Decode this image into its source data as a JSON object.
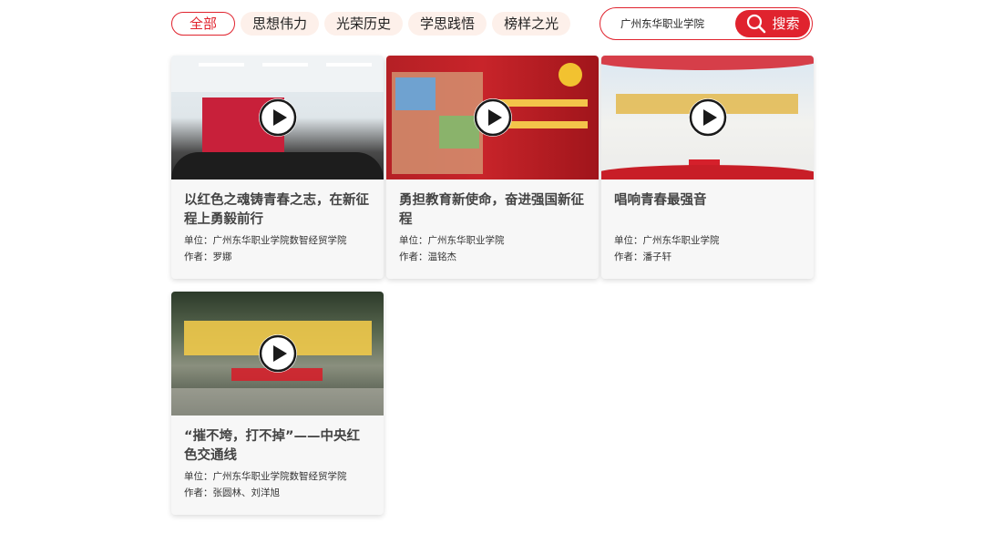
{
  "tabs": [
    {
      "label": "全部",
      "active": true
    },
    {
      "label": "思想伟力",
      "active": false
    },
    {
      "label": "光荣历史",
      "active": false
    },
    {
      "label": "学思践悟",
      "active": false
    },
    {
      "label": "榜样之光",
      "active": false
    }
  ],
  "search": {
    "value": "广州东华职业学院",
    "button_label": "搜索",
    "icon": "search-icon"
  },
  "videos": [
    {
      "title": "以红色之魂铸青春之志，在新征程上勇毅前行",
      "unit": "单位：广州东华职业学院数智经贸学院",
      "author": "作者：罗娜"
    },
    {
      "title": "勇担教育新使命，奋进强国新征程",
      "unit": "单位：广州东华职业学院",
      "author": "作者：温铭杰"
    },
    {
      "title": "唱响青春最强音",
      "unit": "单位：广州东华职业学院",
      "author": "作者：潘子轩"
    },
    {
      "title": "“摧不垮，打不掉”——中央红色交通线",
      "unit": "单位：广州东华职业学院数智经贸学院",
      "author": "作者：张圆林、刘洋旭"
    }
  ],
  "colors": {
    "accent": "#e0232e",
    "tab_bg": "#fdf0ea",
    "card_bg": "#f7f7f7"
  }
}
